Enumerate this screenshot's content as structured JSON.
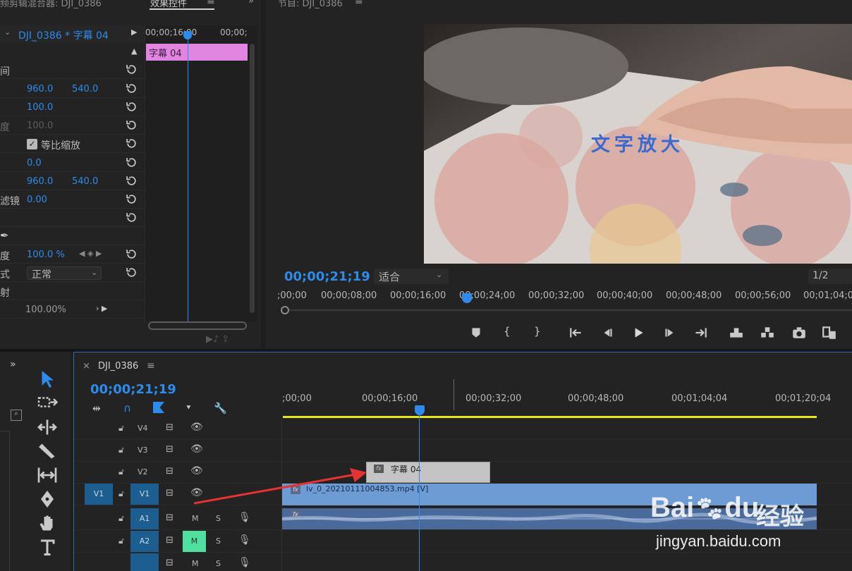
{
  "source_panel": {
    "title_truncated": "频剪辑混合器: DJI_0386",
    "tab_effect_controls": "效果控件",
    "menu_icon": "hamburger-icon",
    "clip_name": "DJI_0386 * 字幕 04",
    "mini_time_1": "00;00;16;00",
    "mini_time_2": "00;00;",
    "mini_clip_label": "字幕 04",
    "rows": [
      {
        "label": "间",
        "v1": "",
        "v2": ""
      },
      {
        "label": "",
        "v1": "960.0",
        "v2": "540.0"
      },
      {
        "label": "",
        "v1": "100.0",
        "v2": ""
      },
      {
        "label": "度",
        "v1": "100.0",
        "v2": ""
      },
      {
        "label": "",
        "v1": "",
        "v2": ""
      },
      {
        "label": "",
        "v1": "0.0",
        "v2": ""
      },
      {
        "label": "",
        "v1": "960.0",
        "v2": "540.0"
      },
      {
        "label": "滤镜",
        "v1": "0.00",
        "v2": ""
      },
      {
        "label": "",
        "v1": "",
        "v2": ""
      },
      {
        "label": "",
        "v1": "",
        "v2": ""
      },
      {
        "label": "度",
        "v1": "100.0 %",
        "v2": ""
      },
      {
        "label": "式",
        "v1": "",
        "v2": ""
      },
      {
        "label": "射",
        "v1": "",
        "v2": ""
      },
      {
        "label": "",
        "v1": "100.00%",
        "v2": ""
      }
    ],
    "uniform_scale_label": "等比缩放",
    "blend_mode_value": "正常"
  },
  "program_monitor": {
    "title_truncated": "节目: DJI_0386",
    "overlay_text": "文字放大",
    "timecode": "00;00;21;19",
    "fit_label": "适合",
    "quality": "1/2",
    "ruler_labels": [
      ";00;00",
      "00;00;08;00",
      "00;00;16;00",
      "00;00;24;00",
      "00;00;32;00",
      "00;00;40;00",
      "00;00;48;00",
      "00;00;56;00",
      "00;01;04;0"
    ],
    "playhead": 0.33
  },
  "timeline": {
    "close_icon": "×",
    "sequence_name": "DJI_0386",
    "timecode": "00;00;21;19",
    "ruler_labels": [
      ";00;00",
      "00;00;16;00",
      "00;00;32;00",
      "00;00;48;00",
      "00;01;04;04",
      "00;01;20;04"
    ],
    "tracks": [
      {
        "name": "V4",
        "kind": "video"
      },
      {
        "name": "V3",
        "kind": "video"
      },
      {
        "name": "V2",
        "kind": "video"
      },
      {
        "name": "V1",
        "kind": "video",
        "source": "V1"
      },
      {
        "name": "A1",
        "kind": "audio",
        "m": "M",
        "s": "S"
      },
      {
        "name": "A2",
        "kind": "audio",
        "m": "M",
        "s": "S"
      },
      {
        "name": "",
        "kind": "audio",
        "m": "M",
        "s": "S"
      }
    ],
    "title_clip": "字幕 04",
    "video_clip": "lv_0_20210111004853.mp4 [V]",
    "fx_label": "fx"
  },
  "watermark": {
    "brand": "Bai",
    "brand2": "du",
    "suffix": "经验",
    "url": "jingyan.baidu.com"
  },
  "colors": {
    "accent_blue": "#2d8ceb",
    "title_clip_pink": "#e085e0",
    "video_clip_blue": "#6d9bd4",
    "work_area_yellow": "#e6e61e",
    "mute_green": "#4fe0a0",
    "track_target_blue": "#1c5e8f",
    "arrow_red": "#e63232"
  }
}
